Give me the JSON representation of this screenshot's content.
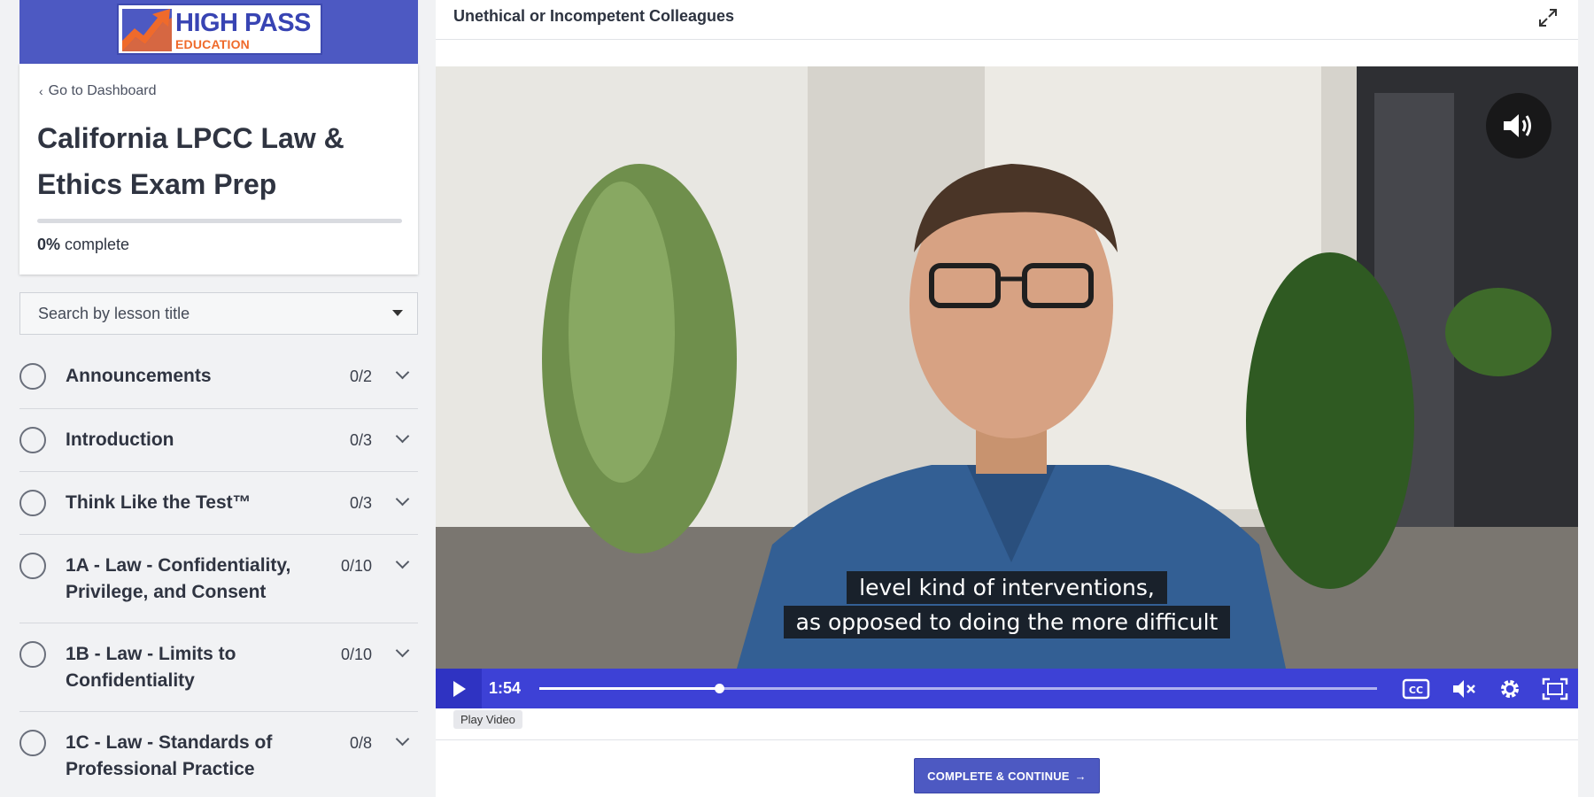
{
  "brand": {
    "name": "HIGH PASS",
    "sub": "EDUCATION",
    "color": "#4d59c2",
    "accent": "#ef6a2b"
  },
  "sidebar": {
    "back_label": "Go to Dashboard",
    "course_title": "California LPCC Law & Ethics Exam Prep",
    "progress_percent": 0,
    "progress_value": "0%",
    "progress_suffix": " complete",
    "search_placeholder": "Search by lesson title",
    "lessons": [
      {
        "title": "Announcements",
        "count": "0/2"
      },
      {
        "title": "Introduction",
        "count": "0/3"
      },
      {
        "title": "Think Like the Test™",
        "count": "0/3"
      },
      {
        "title": "1A - Law - Confidentiality, Privilege, and Consent",
        "count": "0/10"
      },
      {
        "title": "1B - Law - Limits to Confidentiality",
        "count": "0/10"
      },
      {
        "title": "1C - Law - Standards of Professional Practice",
        "count": "0/8"
      }
    ]
  },
  "main": {
    "lesson_title": "Unethical or Incompetent Colleagues",
    "video": {
      "caption_line1": "level kind of interventions,",
      "caption_line2": "as opposed to doing the more difficult",
      "time": "1:54",
      "progress_fraction": 0.215,
      "play_tooltip": "Play Video",
      "controls_color": "#3d41d6"
    },
    "complete_button": "COMPLETE & CONTINUE",
    "complete_arrow": "→"
  }
}
